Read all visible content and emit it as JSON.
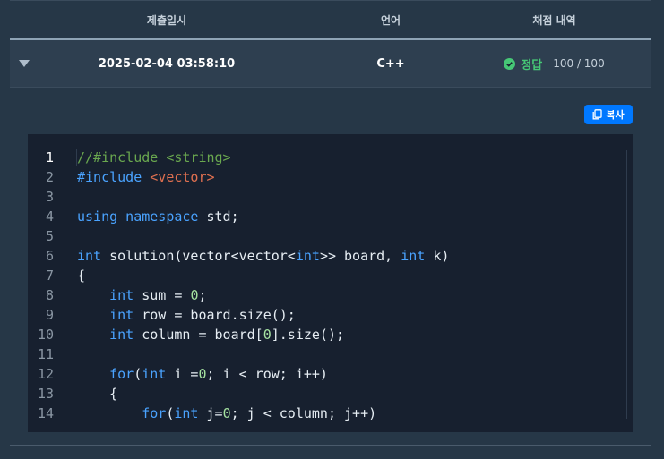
{
  "table": {
    "headers": [
      "제출일시",
      "언어",
      "채점 내역"
    ],
    "row": {
      "datetime": "2025-02-04 03:58:10",
      "language": "C++",
      "result": "정답",
      "score": "100 / 100"
    }
  },
  "copy_button": {
    "label": "복사"
  },
  "colors": {
    "background": "#263747",
    "accent_blue": "#0078ff",
    "success_green": "#46c876",
    "editor_bg": "#17202f"
  },
  "editor": {
    "active_line": 1,
    "lines": [
      {
        "n": "1",
        "tokens": [
          {
            "t": "//#include <string>",
            "c": "c"
          }
        ]
      },
      {
        "n": "2",
        "tokens": [
          {
            "t": "#include ",
            "c": "k"
          },
          {
            "t": "<vector>",
            "c": "s"
          }
        ]
      },
      {
        "n": "3",
        "tokens": []
      },
      {
        "n": "4",
        "tokens": [
          {
            "t": "using namespace ",
            "c": "k"
          },
          {
            "t": "std;",
            "c": ""
          }
        ]
      },
      {
        "n": "5",
        "tokens": []
      },
      {
        "n": "6",
        "tokens": [
          {
            "t": "int",
            "c": "k"
          },
          {
            "t": " solution(vector<vector<",
            "c": ""
          },
          {
            "t": "int",
            "c": "k"
          },
          {
            "t": ">> board, ",
            "c": ""
          },
          {
            "t": "int",
            "c": "k"
          },
          {
            "t": " k)",
            "c": ""
          }
        ]
      },
      {
        "n": "7",
        "tokens": [
          {
            "t": "{",
            "c": ""
          }
        ]
      },
      {
        "n": "8",
        "tokens": [
          {
            "t": "    ",
            "c": ""
          },
          {
            "t": "int",
            "c": "k"
          },
          {
            "t": " sum = ",
            "c": ""
          },
          {
            "t": "0",
            "c": "n"
          },
          {
            "t": ";",
            "c": ""
          }
        ]
      },
      {
        "n": "9",
        "tokens": [
          {
            "t": "    ",
            "c": ""
          },
          {
            "t": "int",
            "c": "k"
          },
          {
            "t": " row = board.size();",
            "c": ""
          }
        ]
      },
      {
        "n": "10",
        "tokens": [
          {
            "t": "    ",
            "c": ""
          },
          {
            "t": "int",
            "c": "k"
          },
          {
            "t": " column = board[",
            "c": ""
          },
          {
            "t": "0",
            "c": "n"
          },
          {
            "t": "].size();",
            "c": ""
          }
        ]
      },
      {
        "n": "11",
        "tokens": []
      },
      {
        "n": "12",
        "tokens": [
          {
            "t": "    ",
            "c": ""
          },
          {
            "t": "for",
            "c": "k"
          },
          {
            "t": "(",
            "c": ""
          },
          {
            "t": "int",
            "c": "k"
          },
          {
            "t": " i =",
            "c": ""
          },
          {
            "t": "0",
            "c": "n"
          },
          {
            "t": "; i < row; i++)",
            "c": ""
          }
        ]
      },
      {
        "n": "13",
        "tokens": [
          {
            "t": "    {",
            "c": ""
          }
        ]
      },
      {
        "n": "14",
        "tokens": [
          {
            "t": "        ",
            "c": ""
          },
          {
            "t": "for",
            "c": "k"
          },
          {
            "t": "(",
            "c": ""
          },
          {
            "t": "int",
            "c": "k"
          },
          {
            "t": " j=",
            "c": ""
          },
          {
            "t": "0",
            "c": "n"
          },
          {
            "t": "; j < column; j++)",
            "c": ""
          }
        ]
      }
    ]
  }
}
